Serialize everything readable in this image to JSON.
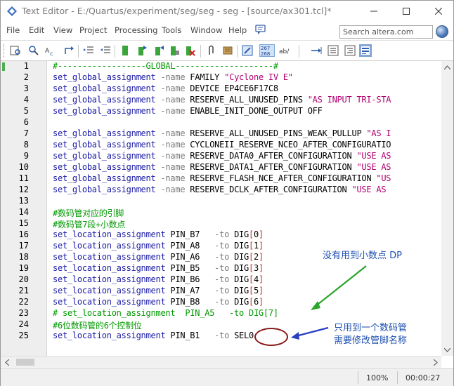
{
  "window": {
    "title": "Text Editor - E:/Quartus/experiment/seg/seg - seg - [source/ax301.tcl]*"
  },
  "menu": [
    "File",
    "Edit",
    "View",
    "Project",
    "Processing",
    "Tools",
    "Window",
    "Help"
  ],
  "search": {
    "placeholder": "Search altera.com"
  },
  "toolbar": {
    "line_number_badge_top": "267",
    "line_number_badge_bottom": "268",
    "ab_label": "ab/"
  },
  "editor": {
    "lines": [
      {
        "n": "1",
        "text": "#------------------GLOBAL--------------------#"
      },
      {
        "n": "2",
        "text": "set_global_assignment -name FAMILY \"Cyclone IV E\""
      },
      {
        "n": "3",
        "text": "set_global_assignment -name DEVICE EP4CE6F17C8"
      },
      {
        "n": "4",
        "text": "set_global_assignment -name RESERVE_ALL_UNUSED_PINS \"AS INPUT TRI-STA"
      },
      {
        "n": "5",
        "text": "set_global_assignment -name ENABLE_INIT_DONE_OUTPUT OFF"
      },
      {
        "n": "6",
        "text": ""
      },
      {
        "n": "7",
        "text": "set_global_assignment -name RESERVE_ALL_UNUSED_PINS_WEAK_PULLUP \"AS I"
      },
      {
        "n": "8",
        "text": "set_global_assignment -name CYCLONEII_RESERVE_NCEO_AFTER_CONFIGURATIO"
      },
      {
        "n": "9",
        "text": "set_global_assignment -name RESERVE_DATA0_AFTER_CONFIGURATION \"USE AS"
      },
      {
        "n": "10",
        "text": "set_global_assignment -name RESERVE_DATA1_AFTER_CONFIGURATION \"USE AS"
      },
      {
        "n": "11",
        "text": "set_global_assignment -name RESERVE_FLASH_NCE_AFTER_CONFIGURATION \"US"
      },
      {
        "n": "12",
        "text": "set_global_assignment -name RESERVE_DCLK_AFTER_CONFIGURATION \"USE AS"
      },
      {
        "n": "13",
        "text": ""
      },
      {
        "n": "14",
        "text": "#数码管对应的引脚"
      },
      {
        "n": "15",
        "text": "#数码管7段+小数点"
      },
      {
        "n": "16",
        "text": "set_location_assignment PIN_B7   -to DIG[0]"
      },
      {
        "n": "17",
        "text": "set_location_assignment PIN_A8   -to DIG[1]"
      },
      {
        "n": "18",
        "text": "set_location_assignment PIN_A6   -to DIG[2]"
      },
      {
        "n": "19",
        "text": "set_location_assignment PIN_B5   -to DIG[3]"
      },
      {
        "n": "20",
        "text": "set_location_assignment PIN_B6   -to DIG[4]"
      },
      {
        "n": "21",
        "text": "set_location_assignment PIN_A7   -to DIG[5]"
      },
      {
        "n": "22",
        "text": "set_location_assignment PIN_B8   -to DIG[6]"
      },
      {
        "n": "23",
        "text": "# set_location_assignment  PIN_A5   -to DIG[7]"
      },
      {
        "n": "24",
        "text": "#6位数码管的6个控制位"
      },
      {
        "n": "25",
        "text": "set_location_assignment PIN_B1   -to SEL0"
      }
    ]
  },
  "annotations": {
    "note1": "没有用到小数点 DP",
    "note2_line1": "只用到一个数码管",
    "note2_line2": "需要修改管脚名称"
  },
  "status": {
    "zoom": "100%",
    "time": "00:00:27"
  },
  "colors": {
    "keyword": "#1a1aa6",
    "string": "#b00070",
    "comment": "#009900",
    "annotation": "#1d4fb0",
    "arrow_green": "#2aa52a",
    "arrow_blue": "#2a3fc4"
  }
}
